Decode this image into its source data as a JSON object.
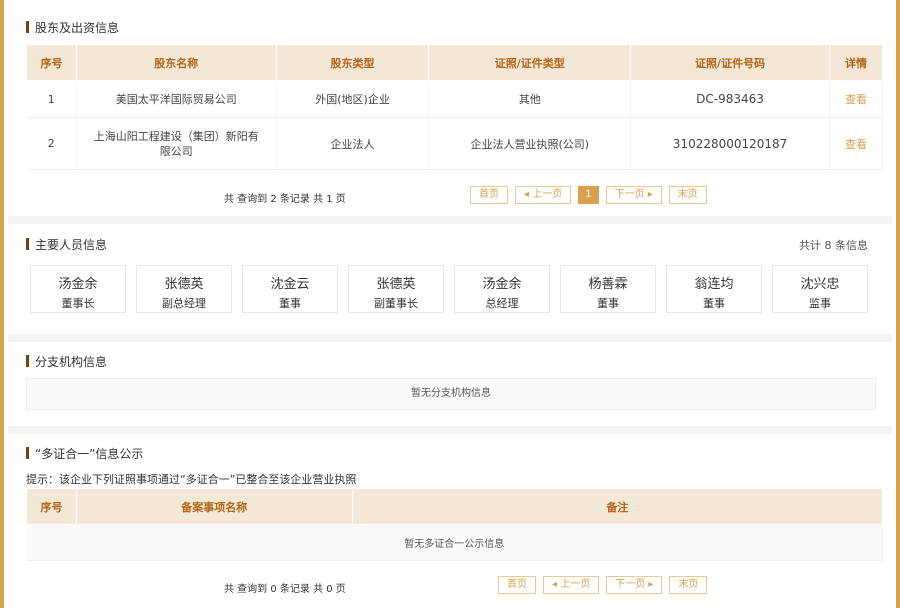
{
  "shareholders": {
    "title": "股东及出资信息",
    "columns": [
      "序号",
      "股东名称",
      "股东类型",
      "证照/证件类型",
      "证照/证件号码",
      "详情"
    ],
    "rows": [
      {
        "no": "1",
        "name": "美国太平洋国际贸易公司",
        "type": "外国(地区)企业",
        "cert_type": "其他",
        "cert_no": "DC-983463",
        "detail": "查看"
      },
      {
        "no": "2",
        "name": "上海山阳工程建设（集团）新阳有限公司",
        "type": "企业法人",
        "cert_type": "企业法人营业执照(公司)",
        "cert_no": "310228000120187",
        "detail": "查看"
      }
    ],
    "total": "共 查询到 2 条记录 共 1 页",
    "pager": {
      "first": "首页",
      "prev": "◂ 上一页",
      "current": "1",
      "next": "下一页 ▸",
      "last": "末页"
    }
  },
  "personnel": {
    "title": "主要人员信息",
    "count": "共计 8 条信息",
    "people": [
      {
        "name": "汤金余",
        "role": "董事长"
      },
      {
        "name": "张德英",
        "role": "副总经理"
      },
      {
        "name": "沈金云",
        "role": "董事"
      },
      {
        "name": "张德英",
        "role": "副董事长"
      },
      {
        "name": "汤金余",
        "role": "总经理"
      },
      {
        "name": "杨善霖",
        "role": "董事"
      },
      {
        "name": "翁连均",
        "role": "董事"
      },
      {
        "name": "沈兴忠",
        "role": "监事"
      }
    ]
  },
  "branches": {
    "title": "分支机构信息",
    "empty": "暂无分支机构信息"
  },
  "multi": {
    "title": "“多证合一”信息公示",
    "hint": "提示：该企业下列证照事项通过“多证合一”已整合至该企业营业执照",
    "columns": [
      "序号",
      "备案事项名称",
      "备注"
    ],
    "empty": "暂无多证合一公示信息",
    "total": "共 查询到 0 条记录 共 0 页",
    "pager": {
      "first": "首页",
      "prev": "◂ 上一页",
      "next": "下一页 ▸",
      "last": "末页"
    }
  },
  "colors": {
    "accent": "#d4a34a",
    "header_bg": "#f3e8d6",
    "header_text": "#b5661c",
    "title_bar": "#7a3d0c"
  }
}
